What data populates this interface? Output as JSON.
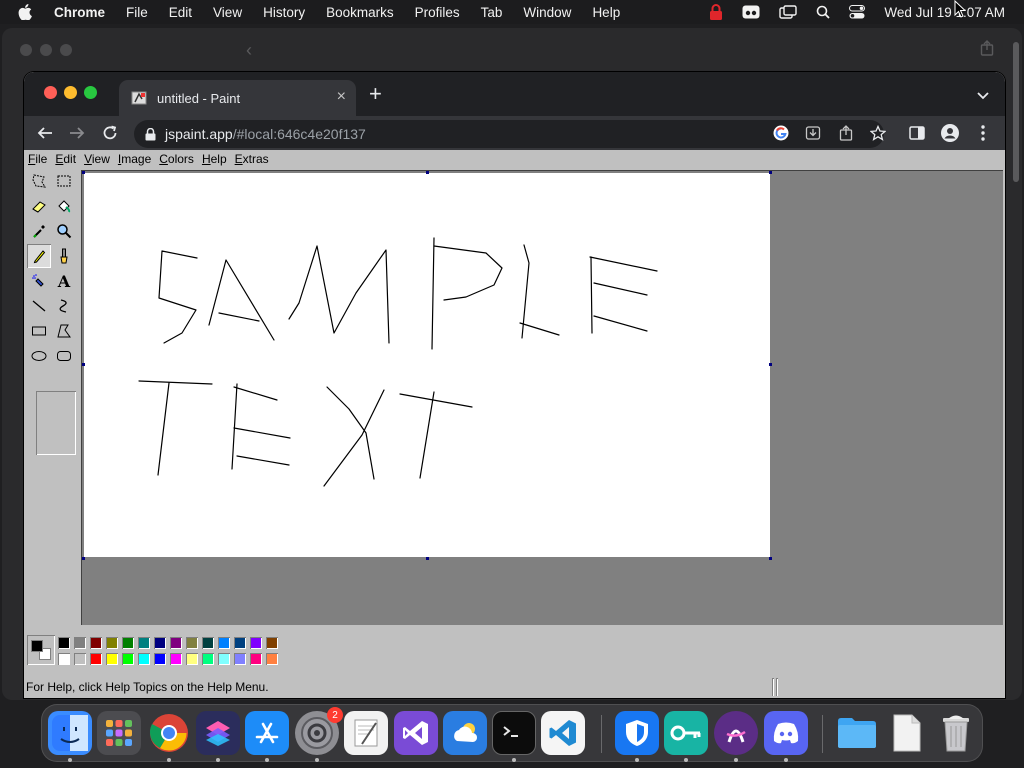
{
  "menubar": {
    "app": "Chrome",
    "items": [
      "File",
      "Edit",
      "View",
      "History",
      "Bookmarks",
      "Profiles",
      "Tab",
      "Window",
      "Help"
    ],
    "clock": "Wed Jul 19  1:07 AM"
  },
  "browser": {
    "tab_title": "untitled - Paint",
    "url_host": "jspaint.app",
    "url_path": "/#local:646c4e20f137"
  },
  "paint": {
    "menu": [
      "File",
      "Edit",
      "View",
      "Image",
      "Colors",
      "Help",
      "Extras"
    ],
    "status_text": "For Help, click Help Topics on the Help Menu.",
    "canvas_text": "SAMPLE TEXT",
    "palette_top": [
      "#000000",
      "#808080",
      "#800000",
      "#808000",
      "#008000",
      "#008080",
      "#000080",
      "#800080",
      "#808040",
      "#004040",
      "#0080ff",
      "#004080",
      "#8000ff",
      "#804000"
    ],
    "palette_bottom": [
      "#ffffff",
      "#c0c0c0",
      "#ff0000",
      "#ffff00",
      "#00ff00",
      "#00ffff",
      "#0000ff",
      "#ff00ff",
      "#ffff80",
      "#00ff80",
      "#80ffff",
      "#8080ff",
      "#ff0080",
      "#ff8040"
    ],
    "foreground": "#000000",
    "background": "#ffffff"
  },
  "dock": {
    "settings_badge": "2"
  }
}
